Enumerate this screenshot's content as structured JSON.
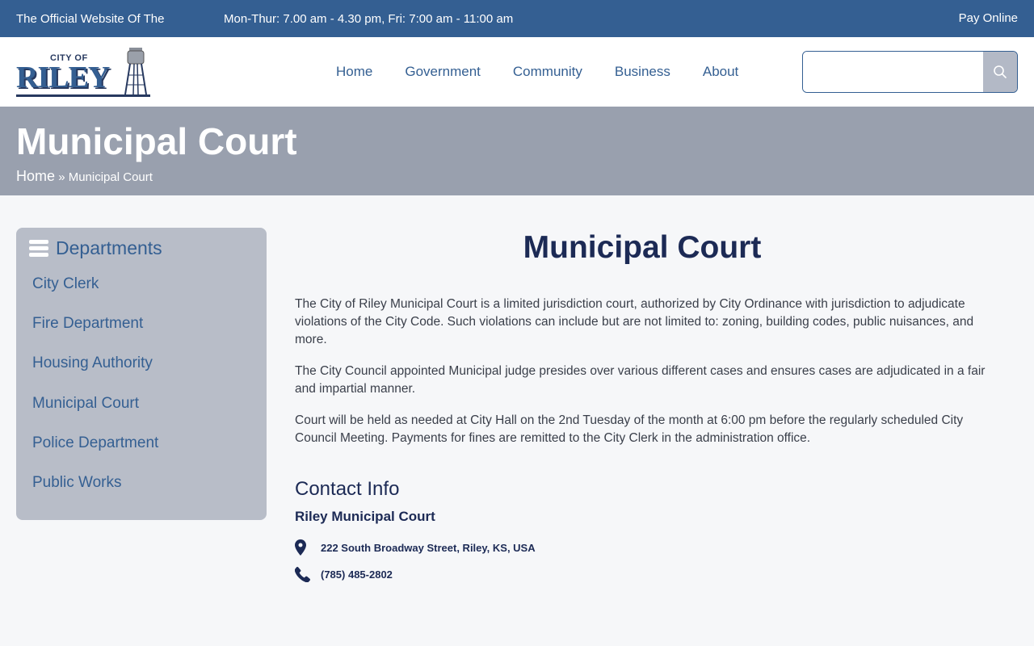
{
  "topbar": {
    "official": "The Official Website Of The",
    "hours": "Mon-Thur: 7.00 am - 4.30 pm, Fri: 7:00 am - 11:00 am",
    "pay_online": "Pay Online"
  },
  "logo": {
    "city_of": "CITY OF",
    "name": "RILEY"
  },
  "nav": [
    "Home",
    "Government",
    "Community",
    "Business",
    "About"
  ],
  "search": {
    "placeholder": "",
    "value": ""
  },
  "banner": {
    "title": "Municipal Court",
    "breadcrumb_home": "Home",
    "breadcrumb_sep": "»",
    "breadcrumb_current": "Municipal Court"
  },
  "sidebar": {
    "heading": "Departments",
    "items": [
      "City Clerk",
      "Fire Department",
      "Housing Authority",
      "Municipal Court",
      "Police Department",
      "Public Works"
    ]
  },
  "main": {
    "title": "Municipal Court",
    "paragraphs": [
      "The City of Riley Municipal Court is a limited jurisdiction court, authorized by City Ordinance with jurisdiction to adjudicate violations of the City Code. Such violations can include but are not limited to: zoning, building codes, public nuisances, and more.",
      "The City Council appointed Municipal judge presides over various different cases and ensures cases are adjudicated in a fair and impartial manner.",
      "Court will be held as needed at City Hall on the 2nd Tuesday of the month at 6:00 pm before the regularly scheduled City Council Meeting.  Payments for fines are remitted to the City Clerk in the administration office."
    ],
    "contact_title": "Contact Info",
    "contact_name": "Riley Municipal Court",
    "address": "222 South Broadway Street, Riley, KS, USA",
    "phone": "(785) 485-2802"
  },
  "colors": {
    "brand_blue": "#345f92",
    "navy": "#1c2a55",
    "banner_gray": "#99a0ae",
    "sidebar_gray": "#b8bdc8"
  },
  "icons": {
    "search": "search-icon",
    "menu": "hamburger-icon",
    "address": "map-pin-icon",
    "phone": "phone-icon",
    "logo_tower": "water-tower-icon"
  }
}
